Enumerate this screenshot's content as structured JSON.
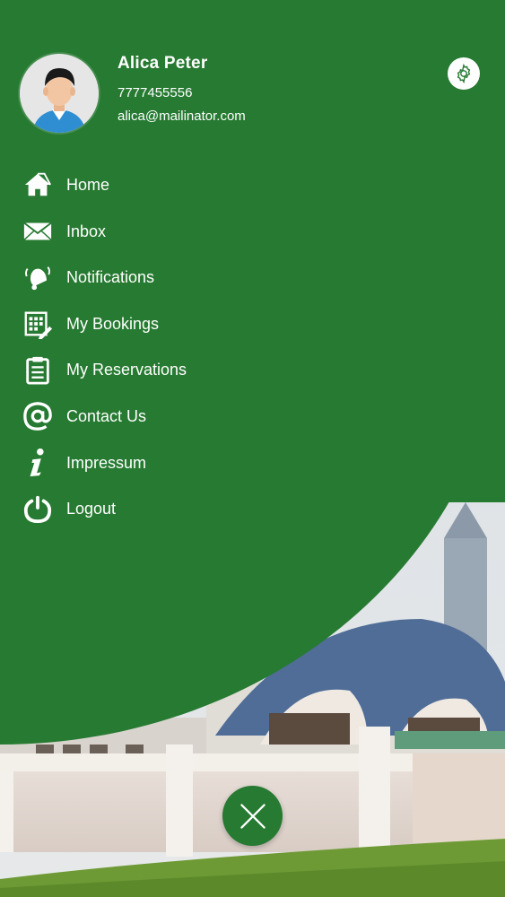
{
  "colors": {
    "drawer_green": "#267a31",
    "text": "#ffffff"
  },
  "user": {
    "name": "Alica Peter",
    "phone": "7777455556",
    "email": "alica@mailinator.com"
  },
  "menu": {
    "items": [
      {
        "label": "Home",
        "icon": "home-icon"
      },
      {
        "label": "Inbox",
        "icon": "envelope-icon"
      },
      {
        "label": "Notifications",
        "icon": "bell-icon"
      },
      {
        "label": "My Bookings",
        "icon": "calendar-icon"
      },
      {
        "label": "My Reservations",
        "icon": "clipboard-icon"
      },
      {
        "label": "Contact Us",
        "icon": "at-icon"
      },
      {
        "label": "Impressum",
        "icon": "info-icon"
      },
      {
        "label": "Logout",
        "icon": "power-icon"
      }
    ]
  }
}
